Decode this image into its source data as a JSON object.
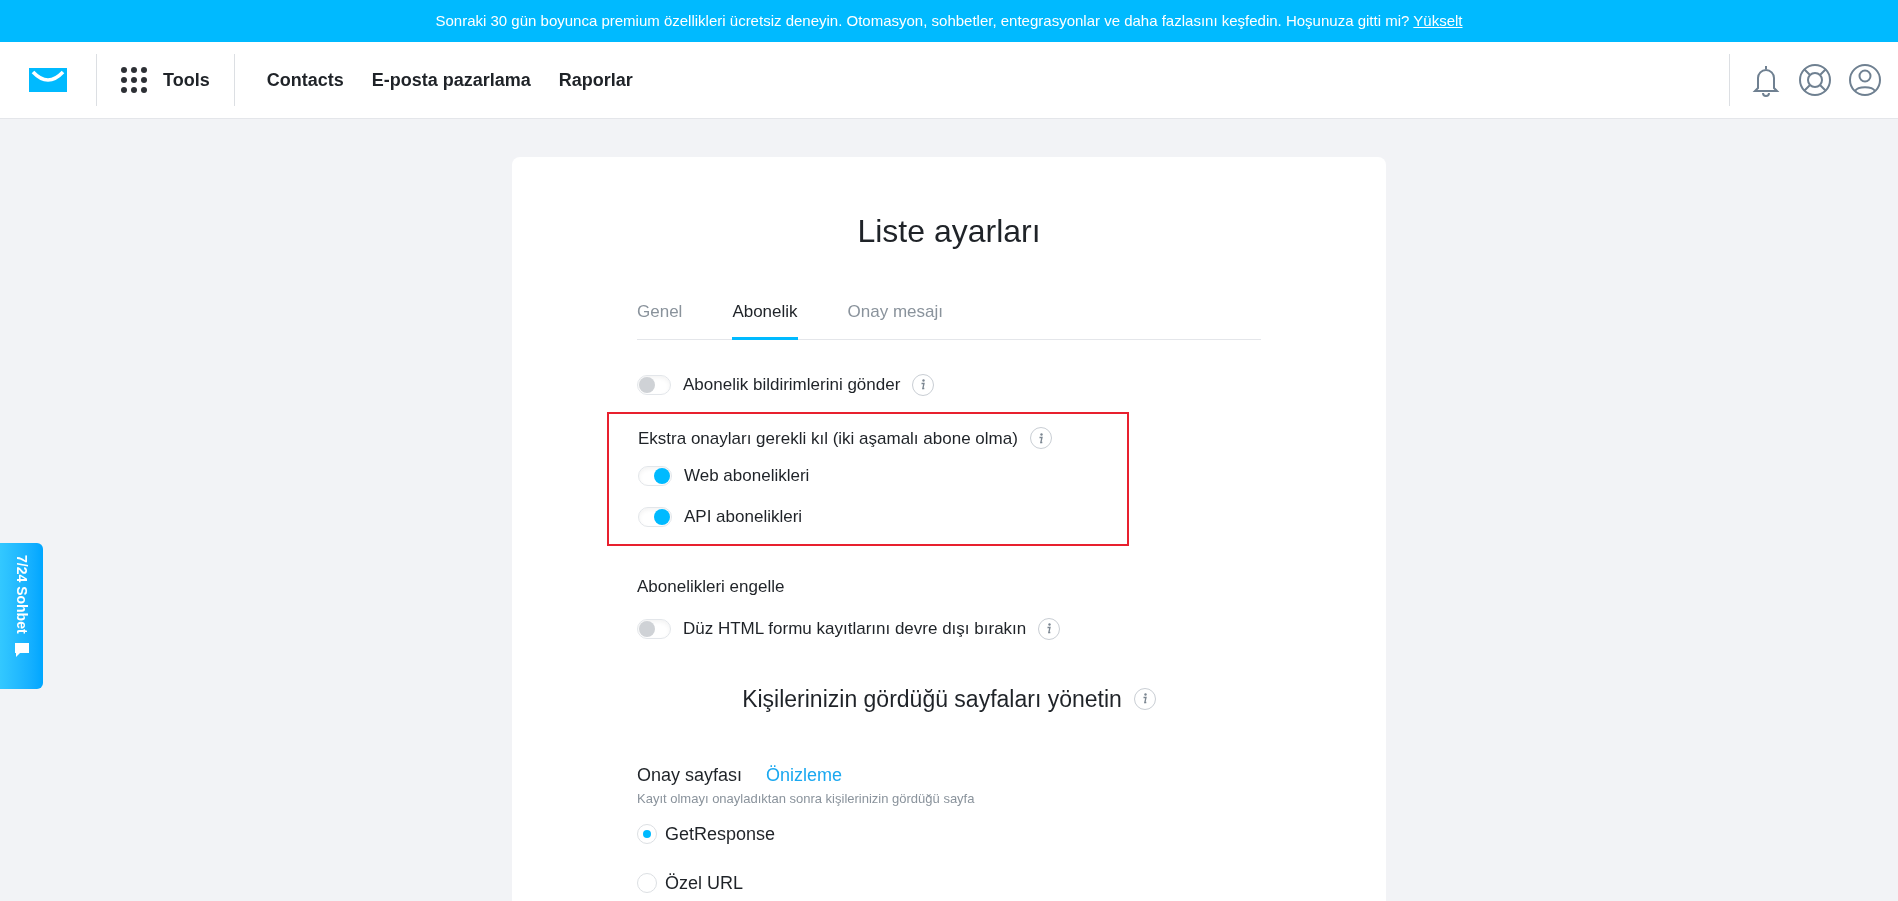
{
  "banner": {
    "text": "Sonraki 30 gün boyunca premium özellikleri ücretsiz deneyin. Otomasyon, sohbetler, entegrasyonlar ve daha fazlasını keşfedin. Hoşunuza gitti mi?",
    "link": "Yükselt"
  },
  "nav": {
    "tools": "Tools",
    "links": [
      "Contacts",
      "E-posta pazarlama",
      "Raporlar"
    ]
  },
  "chat_tab": {
    "label": "7/24 Sohbet"
  },
  "card": {
    "title": "Liste ayarları",
    "tabs": [
      {
        "label": "Genel",
        "selected": false
      },
      {
        "label": "Abonelik",
        "selected": true
      },
      {
        "label": "Onay mesajı",
        "selected": false
      }
    ],
    "notifications": {
      "label": "Abonelik bildirimlerini gönder",
      "on": false
    },
    "double_optin": {
      "heading": "Ekstra onayları gerekli kıl (iki aşamalı abone olma)",
      "highlighted": true,
      "toggles": [
        {
          "label": "Web abonelikleri",
          "on": true
        },
        {
          "label": "API abonelikleri",
          "on": true
        }
      ]
    },
    "block": {
      "heading": "Abonelikleri engelle",
      "toggle": {
        "label": "Düz HTML formu kayıtlarını devre dışı bırakın",
        "on": false
      }
    },
    "pages_heading": "Kişilerinizin gördüğü sayfaları yönetin",
    "confirm_page": {
      "label": "Onay sayfası",
      "preview": "Önizleme",
      "hint": "Kayıt olmayı onayladıktan sonra kişilerinizin gördüğü sayfa",
      "options": [
        {
          "label": "GetResponse",
          "selected": true
        },
        {
          "label": "Özel URL",
          "selected": false
        }
      ]
    }
  }
}
